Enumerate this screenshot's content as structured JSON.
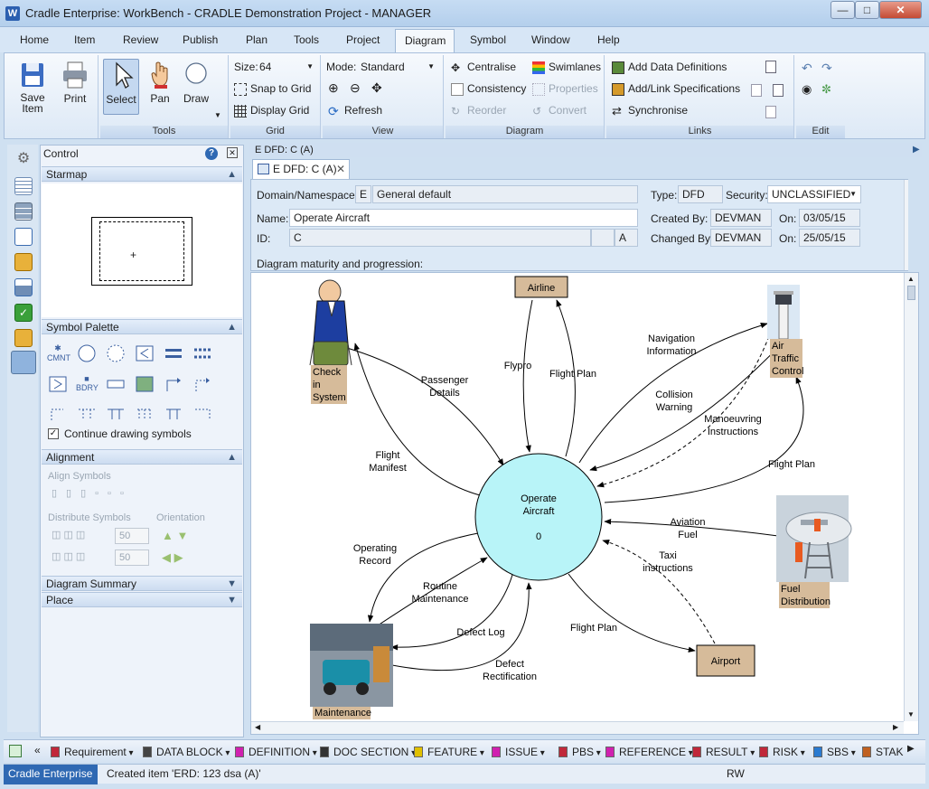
{
  "window": {
    "title": "Cradle Enterprise: WorkBench - CRADLE Demonstration Project - MANAGER",
    "app_icon": "W"
  },
  "menu": {
    "tabs": [
      "Home",
      "Item",
      "Review",
      "Publish",
      "Plan",
      "Tools",
      "Project",
      "Diagram",
      "Symbol",
      "Window",
      "Help"
    ],
    "active": "Diagram"
  },
  "ribbon": {
    "save_item": "Save Item",
    "print": "Print",
    "tools": {
      "select": "Select",
      "pan": "Pan",
      "draw": "Draw",
      "label": "Tools"
    },
    "grid": {
      "size_label": "Size:",
      "size_value": "64",
      "snap": "Snap to Grid",
      "display": "Display Grid",
      "label": "Grid"
    },
    "view": {
      "mode_label": "Mode:",
      "mode_value": "Standard",
      "refresh": "Refresh",
      "label": "View"
    },
    "diagram": {
      "centralise": "Centralise",
      "swimlanes": "Swimlanes",
      "consistency": "Consistency",
      "properties": "Properties",
      "reorder": "Reorder",
      "convert": "Convert",
      "label": "Diagram"
    },
    "links": {
      "add_data": "Add Data Definitions",
      "add_link": "Add/Link Specifications",
      "synchronise": "Synchronise",
      "label": "Links"
    },
    "edit": {
      "label": "Edit"
    }
  },
  "control": {
    "title": "Control",
    "starmap": "Starmap",
    "palette": "Symbol Palette",
    "palette_cmnt": "CMNT",
    "palette_bdry": "BDRY",
    "continue_drawing": "Continue drawing symbols",
    "alignment": "Alignment",
    "align_symbols": "Align Symbols",
    "distribute_symbols": "Distribute Symbols",
    "orientation": "Orientation",
    "spacing_1": "50",
    "spacing_2": "50",
    "diagram_summary": "Diagram Summary",
    "place": "Place"
  },
  "editor": {
    "title": "E DFD: C (A)",
    "tab": "E DFD: C (A)",
    "domain_label": "Domain/Namespace:",
    "domain_code": "E",
    "domain_name": "General default",
    "name_label": "Name:",
    "name_value": "Operate Aircraft",
    "id_label": "ID:",
    "id_value": "C",
    "id_version": "A",
    "type_label": "Type:",
    "type_value": "DFD",
    "security_label": "Security:",
    "security_value": "UNCLASSIFIED",
    "created_label": "Created By:",
    "created_by": "DEVMAN",
    "created_on_label": "On:",
    "created_on": "03/05/15",
    "changed_label": "Changed By:",
    "changed_by": "DEVMAN",
    "changed_on_label": "On:",
    "changed_on": "25/05/15",
    "maturity": "Diagram maturity and progression:"
  },
  "diagram": {
    "process": {
      "name": "Operate Aircraft",
      "number": "0"
    },
    "terminators": {
      "airline": "Airline",
      "airport": "Airport",
      "checkin": [
        "Check",
        "in",
        "System"
      ],
      "atc": [
        "Air",
        "Traffic",
        "Control"
      ],
      "fuel": [
        "Fuel",
        "Distribution"
      ],
      "maintenance": "Maintenance"
    },
    "flows": {
      "flypro": "Flypro",
      "flight_plan_airline": "Flight Plan",
      "passenger_details": [
        "Passenger",
        "Details"
      ],
      "flight_manifest": [
        "Flight",
        "Manifest"
      ],
      "nav_info": [
        "Navigation",
        "Information"
      ],
      "collision": [
        "Collision",
        "Warning"
      ],
      "manoeuvring": [
        "Manoeuvring",
        "Instructions"
      ],
      "flight_plan_atc": "Flight Plan",
      "aviation_fuel": [
        "Aviation",
        "Fuel"
      ],
      "taxi": [
        "Taxi",
        "instructions"
      ],
      "flight_plan_airport": "Flight Plan",
      "operating_record": [
        "Operating",
        "Record"
      ],
      "routine_maint": [
        "Routine",
        "Maintenance"
      ],
      "defect_log": "Defect Log",
      "defect_rect": [
        "Defect",
        "Rectification"
      ]
    }
  },
  "navbar": {
    "items": [
      "Requirement",
      "DATA BLOCK",
      "DEFINITION",
      "DOC SECTION",
      "FEATURE",
      "ISSUE",
      "PBS",
      "REFERENCE",
      "RESULT",
      "RISK",
      "SBS",
      "STAK"
    ],
    "colors": [
      "#c0283a",
      "#444444",
      "#d020b0",
      "#333333",
      "#e0c000",
      "#d020b0",
      "#c0283a",
      "#d020b0",
      "#c0283a",
      "#c0283a",
      "#2a7ad0",
      "#c06020"
    ]
  },
  "status": {
    "app": "Cradle Enterprise",
    "message": "Created item 'ERD: 123 dsa (A)'",
    "mode": "RW"
  }
}
